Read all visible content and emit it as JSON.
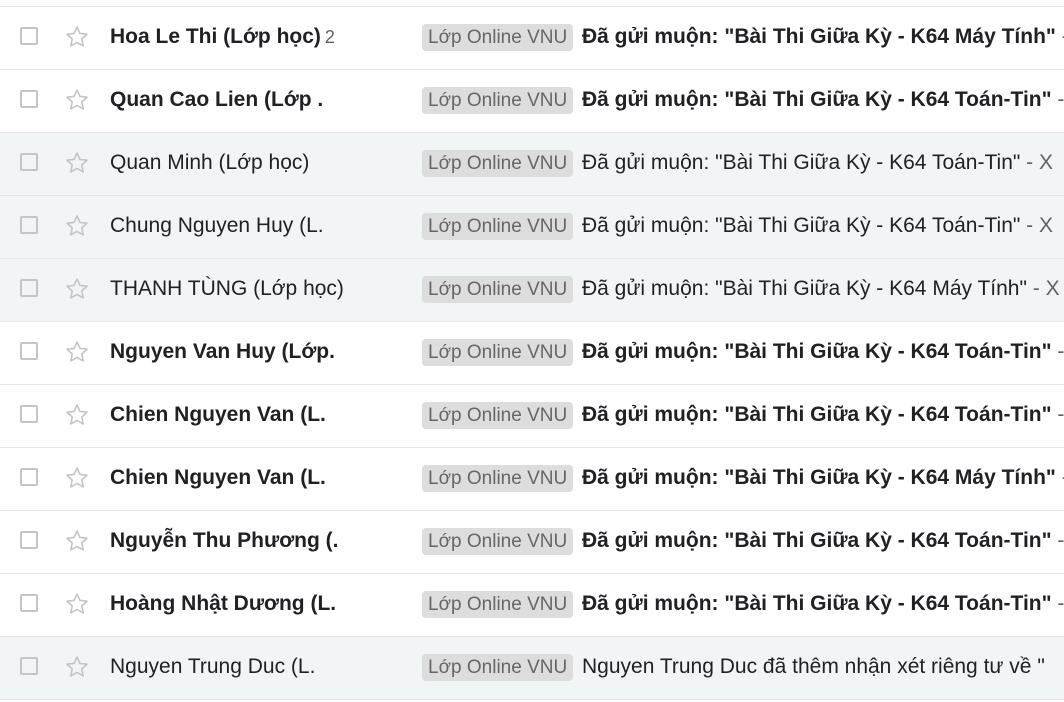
{
  "rows": [
    {
      "sender": "Hoa Le Thi (Lớp học)",
      "count": "2",
      "label": "Lớp Online VNU",
      "subject": "Đã gửi muộn: \"Bài Thi Giữa Kỳ - K64 Máy Tính\"",
      "snippet": " - ",
      "unread": true
    },
    {
      "sender": "Quan Cao Lien (Lớp .",
      "count": "",
      "label": "Lớp Online VNU",
      "subject": "Đã gửi muộn: \"Bài Thi Giữa Kỳ - K64 Toán-Tin\"",
      "snippet": " - ",
      "unread": true
    },
    {
      "sender": "Quan Minh (Lớp học)",
      "count": "",
      "label": "Lớp Online VNU",
      "subject": "Đã gửi muộn: \"Bài Thi Giữa Kỳ - K64 Toán-Tin\"",
      "snippet": " - X",
      "unread": false
    },
    {
      "sender": "Chung Nguyen Huy (L.",
      "count": "",
      "label": "Lớp Online VNU",
      "subject": "Đã gửi muộn: \"Bài Thi Giữa Kỳ - K64 Toán-Tin\"",
      "snippet": " - X",
      "unread": false
    },
    {
      "sender": "THANH TÙNG (Lớp học)",
      "count": "",
      "label": "Lớp Online VNU",
      "subject": "Đã gửi muộn: \"Bài Thi Giữa Kỳ - K64 Máy Tính\"",
      "snippet": " - X",
      "unread": false
    },
    {
      "sender": "Nguyen Van Huy (Lớp.",
      "count": "",
      "label": "Lớp Online VNU",
      "subject": "Đã gửi muộn: \"Bài Thi Giữa Kỳ - K64 Toán-Tin\"",
      "snippet": " - ",
      "unread": true
    },
    {
      "sender": "Chien Nguyen Van (L.",
      "count": "",
      "label": "Lớp Online VNU",
      "subject": "Đã gửi muộn: \"Bài Thi Giữa Kỳ - K64 Toán-Tin\"",
      "snippet": " - ",
      "unread": true
    },
    {
      "sender": "Chien Nguyen Van (L.",
      "count": "",
      "label": "Lớp Online VNU",
      "subject": "Đã gửi muộn: \"Bài Thi Giữa Kỳ - K64 Máy Tính\"",
      "snippet": " - ",
      "unread": true
    },
    {
      "sender": "Nguyễn Thu Phương (.",
      "count": "",
      "label": "Lớp Online VNU",
      "subject": "Đã gửi muộn: \"Bài Thi Giữa Kỳ - K64 Toán-Tin\"",
      "snippet": " - ",
      "unread": true
    },
    {
      "sender": "Hoàng Nhật Dương (L.",
      "count": "",
      "label": "Lớp Online VNU",
      "subject": "Đã gửi muộn: \"Bài Thi Giữa Kỳ - K64 Toán-Tin\"",
      "snippet": " - ",
      "unread": true
    },
    {
      "sender": "Nguyen Trung Duc (L.",
      "count": "",
      "label": "Lớp Online VNU",
      "subject": "Nguyen Trung Duc đã thêm nhận xét riêng tư về \"",
      "snippet": "",
      "unread": false
    }
  ],
  "icons": {
    "checkbox": "checkbox-icon",
    "star": "star-outline-icon"
  },
  "colors": {
    "label_bg": "#dddddd",
    "label_text": "#666666",
    "read_row_bg": "#f2f5f5",
    "divider": "#e4e6e8"
  }
}
